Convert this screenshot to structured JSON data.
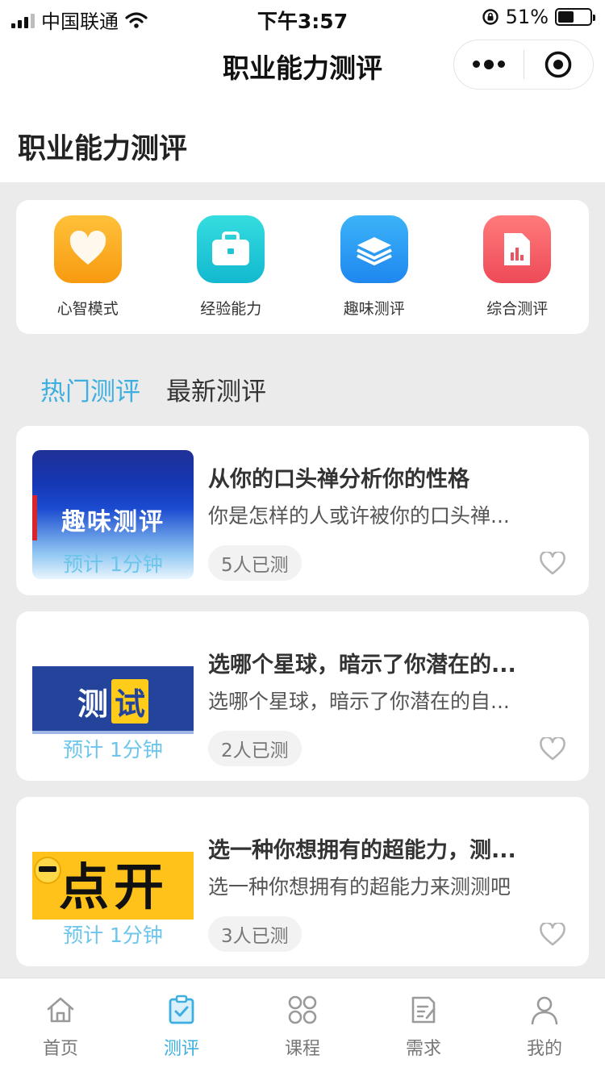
{
  "status_bar": {
    "carrier": "中国联通",
    "time": "下午3:57",
    "battery": "51%",
    "battery_level": 0.51
  },
  "nav": {
    "title": "职业能力测评"
  },
  "page": {
    "heading": "职业能力测评"
  },
  "categories": [
    {
      "label": "心智模式",
      "icon": "heart-icon",
      "color": "#f8a51c"
    },
    {
      "label": "经验能力",
      "icon": "briefcase-icon",
      "color": "#1dcad4"
    },
    {
      "label": "趣味测评",
      "icon": "layers-icon",
      "color": "#2a9cf5"
    },
    {
      "label": "综合测评",
      "icon": "chart-doc-icon",
      "color": "#f2565f"
    }
  ],
  "tabs": [
    {
      "label": "热门测评",
      "active": true
    },
    {
      "label": "最新测评",
      "active": false
    }
  ],
  "tests": [
    {
      "thumb_text": "趣味测评",
      "duration": "预计 1分钟",
      "title": "从你的口头禅分析你的性格",
      "desc": "你是怎样的人或许被你的口头禅...",
      "count": "5人已测"
    },
    {
      "thumb_text": "测试",
      "duration": "预计 1分钟",
      "title": "选哪个星球，暗示了你潜在的...",
      "desc": "选哪个星球，暗示了你潜在的自...",
      "count": "2人已测"
    },
    {
      "thumb_text": "点开",
      "duration": "预计 1分钟",
      "title": "选一种你想拥有的超能力，测...",
      "desc": "选一种你想拥有的超能力来测测吧",
      "count": "3人已测"
    }
  ],
  "tabbar": [
    {
      "label": "首页",
      "icon": "home-icon",
      "active": false
    },
    {
      "label": "测评",
      "icon": "clipboard-check-icon",
      "active": true
    },
    {
      "label": "课程",
      "icon": "grid-icon",
      "active": false
    },
    {
      "label": "需求",
      "icon": "edit-doc-icon",
      "active": false
    },
    {
      "label": "我的",
      "icon": "user-icon",
      "active": false
    }
  ],
  "colors": {
    "accent": "#3cafe0",
    "background": "#ebebeb"
  }
}
